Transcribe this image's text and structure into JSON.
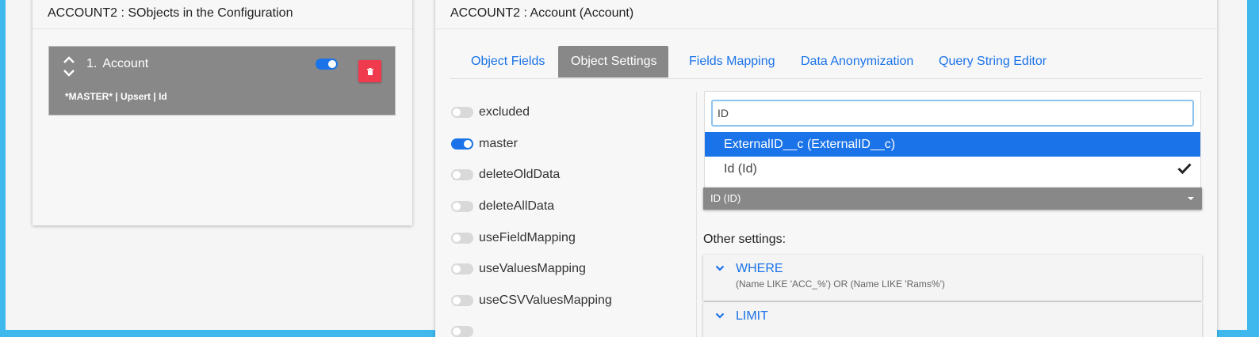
{
  "left_panel": {
    "header": "ACCOUNT2 : SObjects in the Configuration",
    "object": {
      "number": "1.",
      "name": "Account",
      "subtitle": "*MASTER* | Upsert | Id",
      "enabled": true
    }
  },
  "right_panel": {
    "header": "ACCOUNT2 : Account (Account)",
    "tabs": [
      {
        "label": "Object Fields",
        "active": false
      },
      {
        "label": "Object Settings",
        "active": true
      },
      {
        "label": "Fields Mapping",
        "active": false
      },
      {
        "label": "Data Anonymization",
        "active": false
      },
      {
        "label": "Query String Editor",
        "active": false
      }
    ],
    "settings": [
      {
        "label": "excluded",
        "on": false
      },
      {
        "label": "master",
        "on": true
      },
      {
        "label": "deleteOldData",
        "on": false
      },
      {
        "label": "deleteAllData",
        "on": false
      },
      {
        "label": "useFieldMapping",
        "on": false
      },
      {
        "label": "useValuesMapping",
        "on": false
      },
      {
        "label": "useCSVValuesMapping",
        "on": false
      }
    ],
    "external_id": {
      "search_value": "ID",
      "options": [
        {
          "label": "ExternalID__c (ExternalID__c)",
          "highlighted": true,
          "selected": false
        },
        {
          "label": "Id (Id)",
          "highlighted": false,
          "selected": true
        }
      ],
      "selected_value": "ID (ID)"
    },
    "other_settings_label": "Other settings:",
    "accordions": [
      {
        "title": "WHERE",
        "subtitle": "(Name LIKE 'ACC_%') OR (Name LIKE 'Rams%')"
      },
      {
        "title": "LIMIT",
        "subtitle": ""
      }
    ]
  },
  "colors": {
    "accent": "#1a73e8",
    "card_gray": "#888888",
    "danger": "#f03a4e",
    "outer_frame": "#3fb8ee"
  },
  "icons": {
    "sort": "sort-icon",
    "delete": "trash-icon",
    "check": "check-icon",
    "caret": "caret-down-icon",
    "chevron": "chevron-down-icon"
  }
}
